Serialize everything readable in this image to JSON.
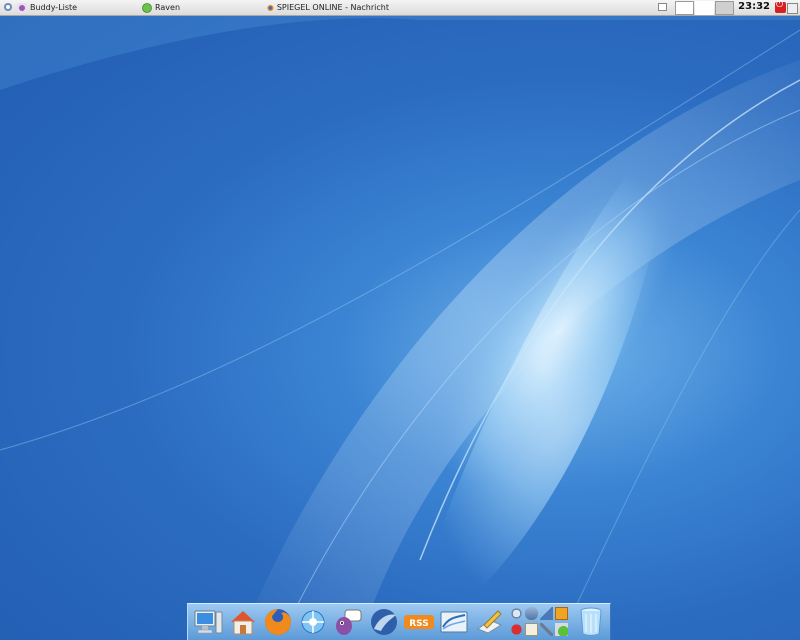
{
  "panel": {
    "tasks": [
      {
        "label": "Buddy-Liste",
        "icon": "pidgin-icon"
      },
      {
        "label": "Raven",
        "icon": "status-online-icon"
      },
      {
        "label": "SPIEGEL ONLINE - Nachricht",
        "icon": "firefox-icon"
      }
    ],
    "pager_desktops": 3,
    "clock": "23:32",
    "power_icon": "power-icon"
  },
  "dock": {
    "launchers": [
      {
        "name": "computer-icon"
      },
      {
        "name": "home-folder-icon"
      },
      {
        "name": "firefox-icon"
      },
      {
        "name": "network-icon"
      },
      {
        "name": "pidgin-icon"
      },
      {
        "name": "thunderbird-icon"
      },
      {
        "name": "rss-feed-icon"
      },
      {
        "name": "openoffice-icon"
      },
      {
        "name": "text-editor-icon"
      }
    ],
    "applets": [
      "network-applet-icon",
      "mail-applet-icon",
      "signal-applet-icon",
      "folder-applet-icon",
      "bug-applet-icon",
      "clipboard-applet-icon",
      "tools-applet-icon",
      "update-applet-icon"
    ],
    "trash": {
      "name": "trash-icon"
    }
  },
  "colors": {
    "accent": "#2b6cc1",
    "panel": "#dcdcdc"
  }
}
